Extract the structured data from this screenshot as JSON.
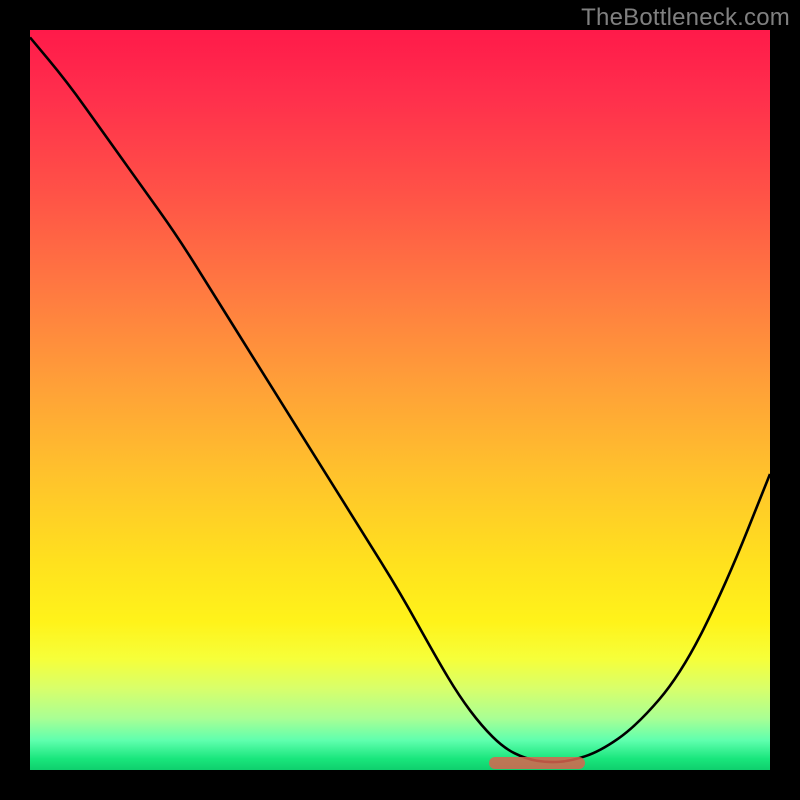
{
  "watermark": "TheBottleneck.com",
  "chart_data": {
    "type": "line",
    "title": "",
    "xlabel": "",
    "ylabel": "",
    "xlim": [
      0,
      100
    ],
    "ylim": [
      0,
      100
    ],
    "grid": false,
    "legend": false,
    "x": [
      0,
      5,
      10,
      15,
      20,
      25,
      30,
      35,
      40,
      45,
      50,
      55,
      58,
      61,
      64,
      67,
      70,
      73,
      77,
      82,
      88,
      94,
      100
    ],
    "y": [
      99,
      93,
      86,
      79,
      72,
      64,
      56,
      48,
      40,
      32,
      24,
      15,
      10,
      6,
      3,
      1.5,
      1,
      1.2,
      2.5,
      6,
      13,
      25,
      40
    ],
    "min_marker": {
      "x_start": 62,
      "x_end": 75,
      "y": 1
    },
    "colors": {
      "line": "#000000",
      "marker": "#d9644f",
      "bg_top": "#ff1a4a",
      "bg_bottom": "#0fcf6d"
    }
  }
}
